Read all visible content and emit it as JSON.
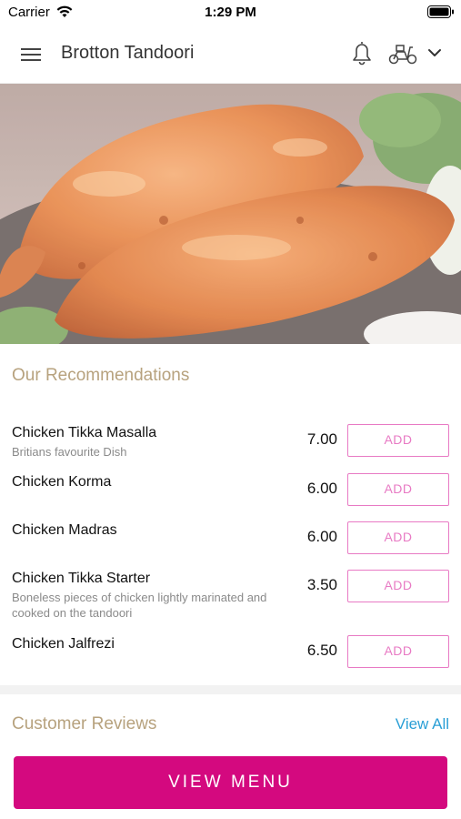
{
  "status_bar": {
    "carrier": "Carrier",
    "time": "1:29 PM",
    "wifi_icon": "wifi-icon",
    "battery_icon": "battery-icon"
  },
  "header": {
    "title": "Brotton Tandoori",
    "menu_icon": "hamburger-menu-icon",
    "bell_icon": "bell-icon",
    "delivery_icon": "scooter-icon",
    "dropdown_icon": "chevron-down-icon"
  },
  "hero": {
    "image": "tandoori-chicken-photo"
  },
  "recommendations": {
    "title": "Our Recommendations",
    "items": [
      {
        "name": "Chicken Tikka Masalla",
        "description": "Britians favourite Dish",
        "price": "7.00",
        "button": "ADD"
      },
      {
        "name": "Chicken Korma",
        "description": "",
        "price": "6.00",
        "button": "ADD"
      },
      {
        "name": "Chicken Madras",
        "description": "",
        "price": "6.00",
        "button": "ADD"
      },
      {
        "name": "Chicken Tikka Starter",
        "description": "Boneless pieces of chicken lightly marinated and cooked on the tandoori",
        "price": "3.50",
        "button": "ADD"
      },
      {
        "name": "Chicken Jalfrezi",
        "description": "",
        "price": "6.50",
        "button": "ADD"
      }
    ]
  },
  "reviews": {
    "title": "Customer Reviews",
    "view_all": "View All"
  },
  "footer": {
    "view_menu": "VIEW MENU"
  },
  "colors": {
    "accent": "#d4097f",
    "add_button": "#e87ac4",
    "section_title": "#b7a27e",
    "link": "#2a9fd6"
  }
}
